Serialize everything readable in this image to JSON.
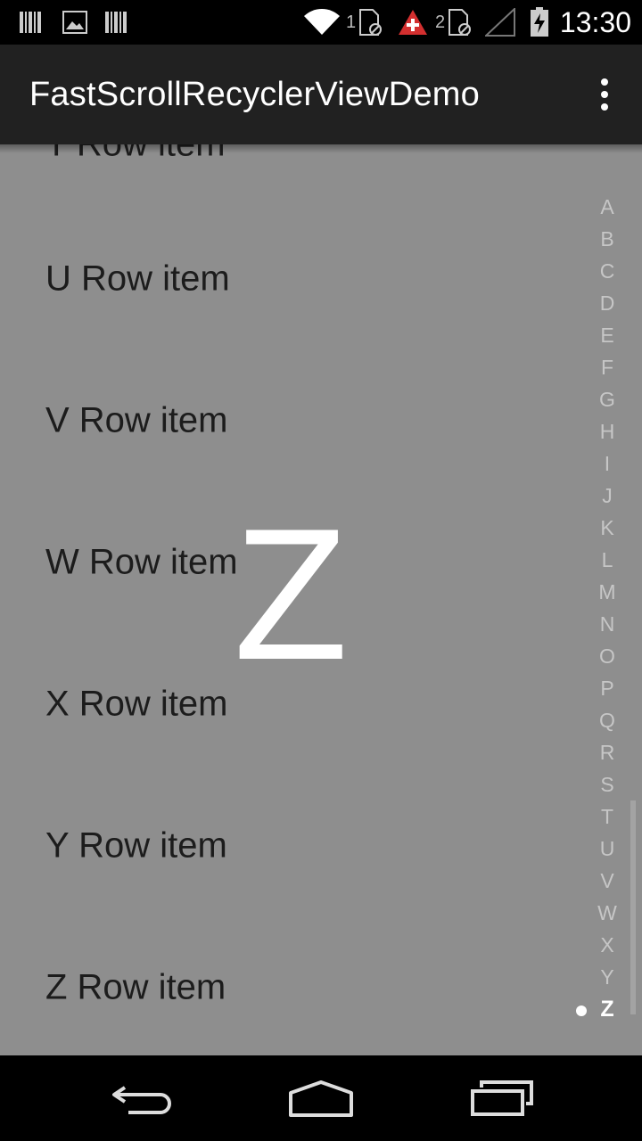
{
  "status_bar": {
    "time": "13:30",
    "sim1_label": "1",
    "sim2_label": "2"
  },
  "app_bar": {
    "title": "FastScrollRecyclerViewDemo",
    "overflow_icon": "more-vert-icon"
  },
  "list": {
    "partial_top_item": "T Row item",
    "items": [
      "U Row item",
      "V Row item",
      "W Row item",
      "X Row item",
      "Y Row item",
      "Z Row item"
    ]
  },
  "fast_scroll": {
    "bubble_letter": "Z",
    "index": [
      "A",
      "B",
      "C",
      "D",
      "E",
      "F",
      "G",
      "H",
      "I",
      "J",
      "K",
      "L",
      "M",
      "N",
      "O",
      "P",
      "Q",
      "R",
      "S",
      "T",
      "U",
      "V",
      "W",
      "X",
      "Y",
      "Z"
    ],
    "selected": "Z"
  },
  "nav_bar": {
    "back_icon": "back-icon",
    "home_icon": "home-icon",
    "recents_icon": "recents-icon"
  },
  "colors": {
    "background": "#8e8e8e",
    "app_bar": "#212121",
    "status_bar": "#000000",
    "alert_red": "#d32f2f"
  }
}
